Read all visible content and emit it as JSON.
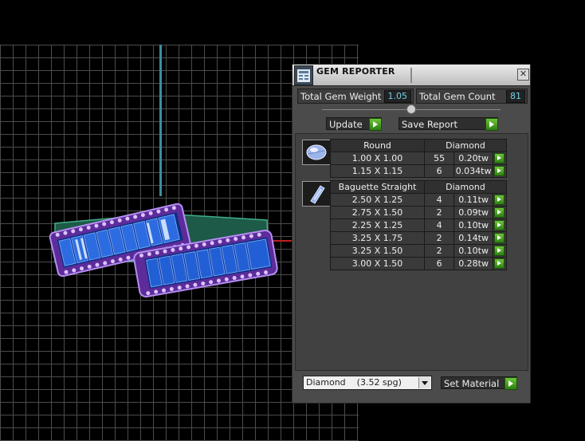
{
  "panel": {
    "title": "GEM REPORTER",
    "close_glyph": "✕",
    "total_weight_label": "Total Gem Weight",
    "total_weight_value": "1.05",
    "total_count_label": "Total Gem Count",
    "total_count_value": "81",
    "update_label": "Update",
    "save_report_label": "Save Report",
    "set_material_label": "Set Material",
    "material_value": "Diamond    (3.52 spg)"
  },
  "groups": [
    {
      "shape": "Round",
      "material": "Diamond",
      "icon": "round-gem-icon",
      "rows": [
        {
          "size": "1.00 X 1.00",
          "count": "55",
          "weight": "0.20tw"
        },
        {
          "size": "1.15 X 1.15",
          "count": "6",
          "weight": "0.034tw"
        }
      ]
    },
    {
      "shape": "Baguette Straight",
      "material": "Diamond",
      "icon": "baguette-gem-icon",
      "rows": [
        {
          "size": "2.50 X 1.25",
          "count": "4",
          "weight": "0.11tw"
        },
        {
          "size": "2.75 X 1.50",
          "count": "2",
          "weight": "0.09tw"
        },
        {
          "size": "2.25 X 1.25",
          "count": "4",
          "weight": "0.10tw"
        },
        {
          "size": "3.25 X 1.75",
          "count": "2",
          "weight": "0.14tw"
        },
        {
          "size": "3.25 X 1.50",
          "count": "2",
          "weight": "0.10tw"
        },
        {
          "size": "3.00 X 1.50",
          "count": "6",
          "weight": "0.28tw"
        }
      ]
    }
  ],
  "colors": {
    "value_text": "#6fd0e8",
    "accent_green": "#3f9d1e",
    "panel_bg": "#4b4b4b",
    "ring_metal": "#7a3fc0",
    "ring_gem": "#1a55c8"
  }
}
